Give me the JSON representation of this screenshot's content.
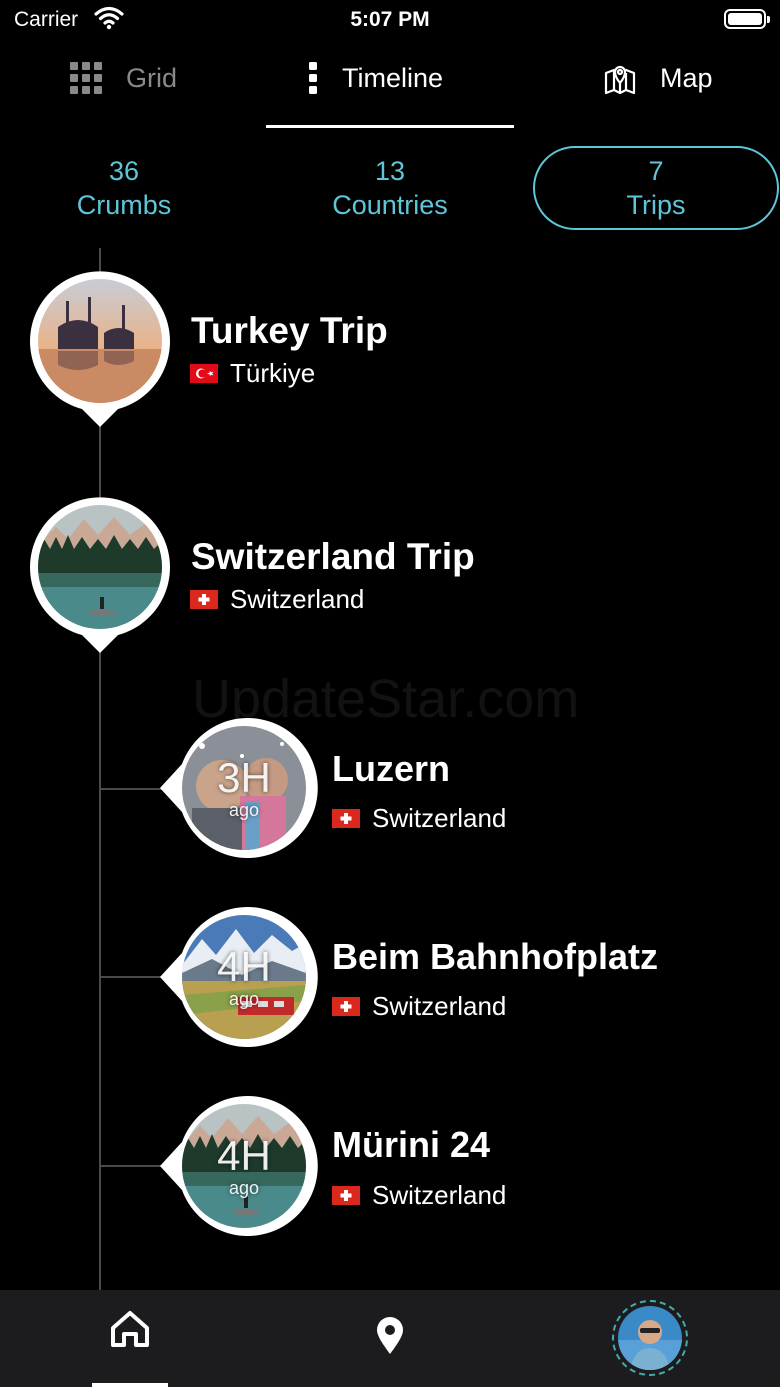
{
  "status_bar": {
    "carrier": "Carrier",
    "time": "5:07 PM"
  },
  "tabs": [
    {
      "label": "Grid",
      "icon": "grid-icon",
      "active": false
    },
    {
      "label": "Timeline",
      "icon": "vertical-dots-icon",
      "active": true
    },
    {
      "label": "Map",
      "icon": "map-icon",
      "active": false
    }
  ],
  "stats": [
    {
      "count": "36",
      "label": "Crumbs",
      "selected": false
    },
    {
      "count": "13",
      "label": "Countries",
      "selected": false
    },
    {
      "count": "7",
      "label": "Trips",
      "selected": true
    }
  ],
  "trips": [
    {
      "title": "Turkey Trip",
      "country": "Türkiye",
      "flag": "turkey-flag-icon"
    },
    {
      "title": "Switzerland Trip",
      "country": "Switzerland",
      "flag": "switzerland-flag-icon"
    }
  ],
  "crumbs": [
    {
      "time": "3H",
      "ago": "ago",
      "title": "Luzern",
      "country": "Switzerland"
    },
    {
      "time": "4H",
      "ago": "ago",
      "title": "Beim Bahnhofplatz",
      "country": "Switzerland"
    },
    {
      "time": "4H",
      "ago": "ago",
      "title": "Mürini 24",
      "country": "Switzerland"
    }
  ],
  "watermark": "UpdateStar.com",
  "bottom_nav": {
    "items": [
      "home-icon",
      "location-pin-icon",
      "profile-avatar"
    ]
  },
  "colors": {
    "accent": "#5fc6d9",
    "background": "#000000",
    "nav_background": "#1c1c1e",
    "muted": "#8a8a8a"
  }
}
